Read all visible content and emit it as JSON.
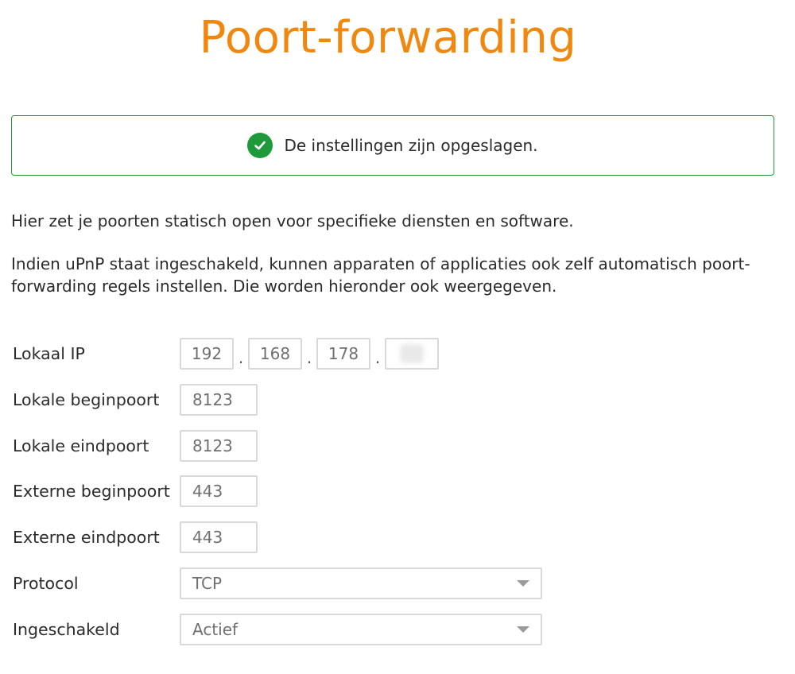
{
  "page": {
    "title": "Poort-forwarding"
  },
  "alert": {
    "icon": "check-circle-icon",
    "color": "#1e9a3a",
    "message": "De instellingen zijn opgeslagen."
  },
  "intro": {
    "line1": "Hier zet je poorten statisch open voor specifieke diensten en software.",
    "line2": "Indien uPnP staat ingeschakeld, kunnen apparaten of applicaties ook zelf automatisch poort-forwarding regels instellen. Die worden hieronder ook weergegeven."
  },
  "form": {
    "local_ip": {
      "label": "Lokaal IP",
      "octets": [
        "192",
        "168",
        "178",
        ""
      ],
      "separator": "."
    },
    "local_start_port": {
      "label": "Lokale beginpoort",
      "value": "8123"
    },
    "local_end_port": {
      "label": "Lokale eindpoort",
      "value": "8123"
    },
    "external_start_port": {
      "label": "Externe beginpoort",
      "value": "443"
    },
    "external_end_port": {
      "label": "Externe eindpoort",
      "value": "443"
    },
    "protocol": {
      "label": "Protocol",
      "value": "TCP"
    },
    "enabled": {
      "label": "Ingeschakeld",
      "value": "Actief"
    }
  },
  "colors": {
    "accent": "#f0880f",
    "success": "#1e9a3a"
  }
}
